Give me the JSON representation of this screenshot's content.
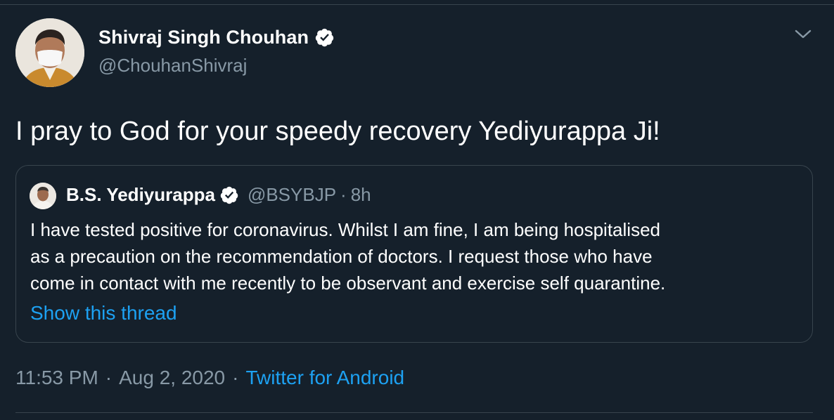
{
  "tweet": {
    "author_name": "Shivraj Singh Chouhan",
    "author_handle": "@ChouhanShivraj",
    "text": "I pray to God for your speedy recovery Yediyurappa Ji!",
    "time": "11:53 PM",
    "separator": "·",
    "date": "Aug 2, 2020",
    "source": "Twitter for Android"
  },
  "quoted_tweet": {
    "author_name": "B.S. Yediyurappa",
    "author_handle": "@BSYBJP",
    "separator": "·",
    "age": "8h",
    "text_lines": [
      "I have tested positive for coronavirus. Whilst I am fine, I am being hospitalised",
      "as a precaution on the recommendation of doctors. I request those who have",
      "come in contact with me recently to be observant and exercise self quarantine."
    ],
    "show_thread_label": "Show this thread"
  },
  "icons": {
    "verified": "verified-badge-icon",
    "menu": "chevron-down-icon"
  },
  "colors": {
    "background": "#15202b",
    "text": "#ffffff",
    "secondary": "#8899a6",
    "link": "#1da1f2",
    "border": "#38444d"
  }
}
